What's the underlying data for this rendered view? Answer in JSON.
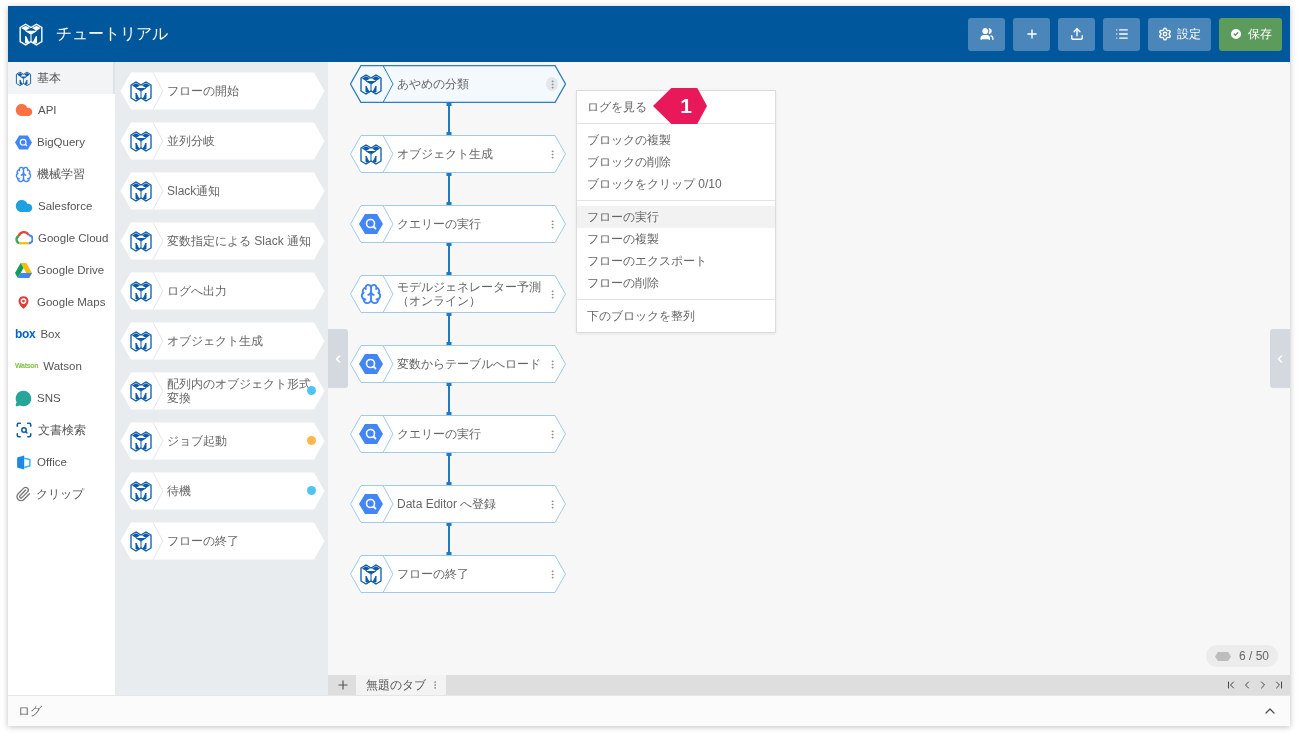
{
  "window": {
    "title": "チュートリアル"
  },
  "toolbar": {
    "buttons": [
      {
        "kind": "users"
      },
      {
        "kind": "add"
      },
      {
        "kind": "upload"
      },
      {
        "kind": "list"
      },
      {
        "kind": "settings",
        "label": "設定"
      },
      {
        "kind": "save",
        "label": "保存"
      }
    ]
  },
  "sidebar": {
    "items": [
      {
        "label": "基本",
        "kind": "basic",
        "selected": true
      },
      {
        "label": "API",
        "kind": "api",
        "selected": false
      },
      {
        "label": "BigQuery",
        "kind": "bigquery",
        "selected": false
      },
      {
        "label": "機械学習",
        "kind": "ml",
        "selected": false
      },
      {
        "label": "Salesforce",
        "kind": "salesforce",
        "selected": false
      },
      {
        "label": "Google Cloud",
        "kind": "gcloud",
        "selected": false
      },
      {
        "label": "Google Drive",
        "kind": "gdrive",
        "selected": false
      },
      {
        "label": "Google Maps",
        "kind": "gmaps",
        "selected": false
      },
      {
        "label": "Box",
        "kind": "box",
        "logo_text": "box",
        "selected": false
      },
      {
        "label": "Watson",
        "kind": "watson",
        "logo_text": "Watson",
        "selected": false
      },
      {
        "label": "SNS",
        "kind": "sns",
        "selected": false
      },
      {
        "label": "文書検索",
        "kind": "docsearch",
        "selected": false
      },
      {
        "label": "Office",
        "kind": "office",
        "selected": false
      },
      {
        "label": "クリップ",
        "kind": "clip",
        "selected": false
      }
    ]
  },
  "palette": {
    "blocks": [
      {
        "label": "フローの開始"
      },
      {
        "label": "並列分岐"
      },
      {
        "label": "Slack通知"
      },
      {
        "label": "変数指定による Slack 通知"
      },
      {
        "label": "ログへ出力"
      },
      {
        "label": "オブジェクト生成"
      },
      {
        "label": "配列内のオブジェクト形式変換",
        "color": "#4fc3f7"
      },
      {
        "label": "ジョブ起動",
        "color": "#ffb74d"
      },
      {
        "label": "待機",
        "color": "#4fc3f7"
      },
      {
        "label": "フローの終了"
      }
    ]
  },
  "flow": {
    "blocks": [
      {
        "label": "あやめの分類",
        "kind": "basic",
        "selected": true
      },
      {
        "label": "オブジェクト生成",
        "kind": "basic",
        "selected": false
      },
      {
        "label": "クエリーの実行",
        "kind": "bigquery",
        "selected": false
      },
      {
        "label": "モデルジェネレーター予測（オンライン）",
        "kind": "ml",
        "selected": false
      },
      {
        "label": "変数からテーブルへロード",
        "kind": "bigquery",
        "selected": false
      },
      {
        "label": "クエリーの実行",
        "kind": "bigquery",
        "selected": false
      },
      {
        "label": "Data Editor へ登録",
        "kind": "bigquery",
        "selected": false
      },
      {
        "label": "フローの終了",
        "kind": "basic",
        "selected": false
      }
    ]
  },
  "context_menu": {
    "groups": [
      [
        {
          "label": "ログを見る",
          "hovered": false
        }
      ],
      [
        {
          "label": "ブロックの複製",
          "hovered": false
        },
        {
          "label": "ブロックの削除",
          "hovered": false
        },
        {
          "label": "ブロックをクリップ 0/10",
          "hovered": false
        }
      ],
      [
        {
          "label": "フローの実行",
          "hovered": true
        },
        {
          "label": "フローの複製",
          "hovered": false
        },
        {
          "label": "フローのエクスポート",
          "hovered": false
        },
        {
          "label": "フローの削除",
          "hovered": false
        }
      ],
      [
        {
          "label": "下のブロックを整列",
          "hovered": false
        }
      ]
    ]
  },
  "callout": {
    "label": "1"
  },
  "block_counter": "6 / 50",
  "tabs": [
    {
      "label": "無題のタブ",
      "selected": true
    }
  ],
  "log_panel": {
    "title": "ログ",
    "expanded": false
  }
}
